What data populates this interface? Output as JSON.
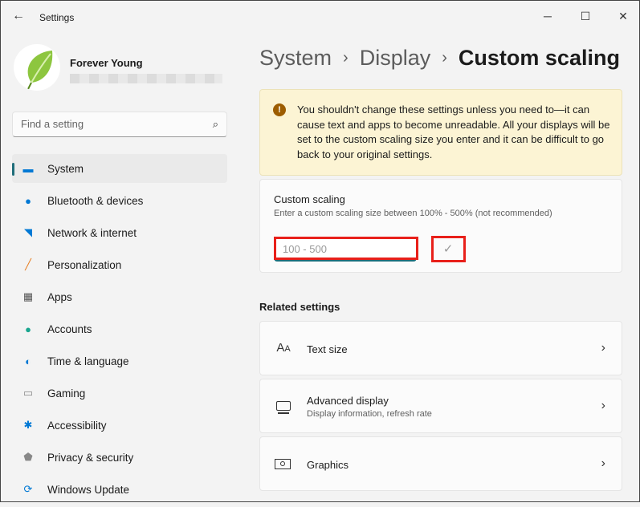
{
  "window": {
    "title": "Settings",
    "back_icon": "back-arrow-icon"
  },
  "user": {
    "name": "Forever Young"
  },
  "search": {
    "placeholder": "Find a setting"
  },
  "nav": [
    {
      "label": "System",
      "icon": "system-icon",
      "color": "#0078d4"
    },
    {
      "label": "Bluetooth & devices",
      "icon": "bluetooth-icon",
      "color": "#0078d4"
    },
    {
      "label": "Network & internet",
      "icon": "wifi-icon",
      "color": "#0078d4"
    },
    {
      "label": "Personalization",
      "icon": "brush-icon",
      "color": "#e67e22"
    },
    {
      "label": "Apps",
      "icon": "apps-icon",
      "color": "#555555"
    },
    {
      "label": "Accounts",
      "icon": "person-icon",
      "color": "#1aa68f"
    },
    {
      "label": "Time & language",
      "icon": "clock-globe-icon",
      "color": "#0078d4"
    },
    {
      "label": "Gaming",
      "icon": "controller-icon",
      "color": "#888888"
    },
    {
      "label": "Accessibility",
      "icon": "accessibility-icon",
      "color": "#0078d4"
    },
    {
      "label": "Privacy & security",
      "icon": "shield-icon",
      "color": "#888888"
    },
    {
      "label": "Windows Update",
      "icon": "update-icon",
      "color": "#0078d4"
    }
  ],
  "breadcrumb": {
    "items": [
      "System",
      "Display"
    ],
    "current": "Custom scaling",
    "sep": "›"
  },
  "warning": {
    "text": "You shouldn't change these settings unless you need to—it can cause text and apps to become unreadable. All your displays will be set to the custom scaling size you enter and it can be difficult to go back to your original settings."
  },
  "custom_scaling": {
    "title": "Custom scaling",
    "subtitle": "Enter a custom scaling size between 100% - 500% (not recommended)",
    "placeholder": "100 - 500",
    "value": ""
  },
  "related": {
    "heading": "Related settings",
    "items": [
      {
        "title": "Text size",
        "subtitle": ""
      },
      {
        "title": "Advanced display",
        "subtitle": "Display information, refresh rate"
      },
      {
        "title": "Graphics",
        "subtitle": ""
      }
    ]
  },
  "colors": {
    "accent": "#1f6d7a",
    "warning_bg": "#fcf4d4",
    "highlight": "#e8201a"
  }
}
